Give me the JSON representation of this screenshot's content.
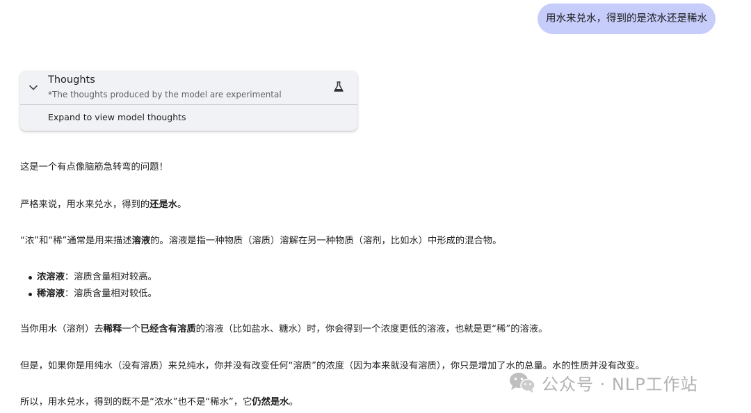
{
  "user_message": "用水来兑水，得到的是浓水还是稀水",
  "thoughts": {
    "title": "Thoughts",
    "subtitle": "*The thoughts produced by the model are experimental",
    "expand_label": "Expand to view model thoughts",
    "icons": [
      "chevron-down-icon",
      "flask-icon"
    ]
  },
  "answer": {
    "p1": "这是一个有点像脑筋急转弯的问题！",
    "p2": {
      "a": "严格来说，用水来兑水，得到的",
      "b": "还是水",
      "c": "。"
    },
    "p3": {
      "a": "“浓”和“稀”通常是用来描述",
      "b": "溶液",
      "c": "的。溶液是指一种物质（溶质）溶解在另一种物质（溶剂，比如水）中形成的混合物。"
    },
    "bullet1": {
      "b": "浓溶液",
      "c": "：溶质含量相对较高。"
    },
    "bullet2": {
      "b": "稀溶液",
      "c": "：溶质含量相对较低。"
    },
    "p4": {
      "a": "当你用水（溶剂）去",
      "b": "稀释",
      "c": "一个",
      "d": "已经含有溶质",
      "e": "的溶液（比如盐水、糖水）时，你会得到一个浓度更低的溶液，也就是更“稀”的溶液。"
    },
    "p5": "但是，如果你是用纯水（没有溶质）来兑纯水，你并没有改变任何“溶质”的浓度（因为本来就没有溶质），你只是增加了水的总量。水的性质并没有改变。",
    "p6": {
      "a": "所以，用水兑水，得到的既不是“浓水”也不是“稀水”，它",
      "b": "仍然是水",
      "c": "。"
    }
  },
  "watermark": {
    "text": "公众号 · NLP工作站",
    "icon": "wechat-icon"
  }
}
